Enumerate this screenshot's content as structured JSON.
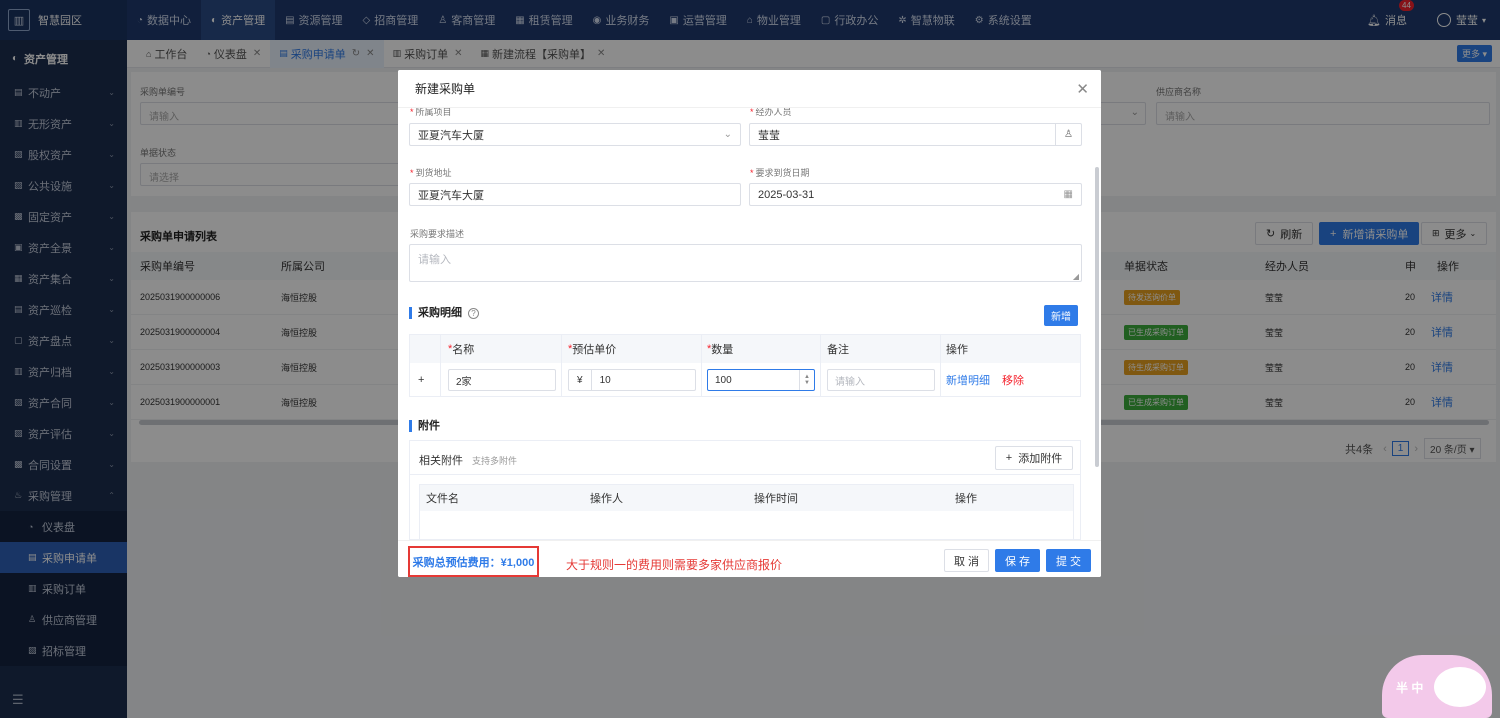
{
  "app": {
    "logo_text": "智慧园区"
  },
  "topnav": [
    {
      "icon": "◔",
      "label": "数据中心"
    },
    {
      "icon": "◐",
      "label": "资产管理",
      "active": true
    },
    {
      "icon": "▤",
      "label": "资源管理"
    },
    {
      "icon": "◇",
      "label": "招商管理"
    },
    {
      "icon": "♙",
      "label": "客商管理"
    },
    {
      "icon": "▦",
      "label": "租赁管理"
    },
    {
      "icon": "◉",
      "label": "业务财务"
    },
    {
      "icon": "▣",
      "label": "运营管理"
    },
    {
      "icon": "⌂",
      "label": "物业管理"
    },
    {
      "icon": "▢",
      "label": "行政办公"
    },
    {
      "icon": "✲",
      "label": "智慧物联"
    },
    {
      "icon": "⚙",
      "label": "系统设置"
    }
  ],
  "top_right": {
    "message_label": "消息",
    "message_count": "44",
    "user_name": "莹莹"
  },
  "sidebar": {
    "title": "资产管理",
    "items": [
      {
        "icon": "▤",
        "label": "不动产"
      },
      {
        "icon": "▥",
        "label": "无形资产"
      },
      {
        "icon": "▧",
        "label": "股权资产"
      },
      {
        "icon": "▨",
        "label": "公共设施"
      },
      {
        "icon": "▩",
        "label": "固定资产"
      },
      {
        "icon": "▣",
        "label": "资产全景"
      },
      {
        "icon": "▦",
        "label": "资产集合"
      },
      {
        "icon": "▤",
        "label": "资产巡检"
      },
      {
        "icon": "▢",
        "label": "资产盘点"
      },
      {
        "icon": "▥",
        "label": "资产归档"
      },
      {
        "icon": "▧",
        "label": "资产合同"
      },
      {
        "icon": "▨",
        "label": "资产评估"
      },
      {
        "icon": "▩",
        "label": "合同设置"
      },
      {
        "icon": "♨",
        "label": "采购管理",
        "open": true
      }
    ],
    "sub_items": [
      {
        "icon": "◔",
        "label": "仪表盘"
      },
      {
        "icon": "▤",
        "label": "采购申请单",
        "active": true
      },
      {
        "icon": "▥",
        "label": "采购订单"
      },
      {
        "icon": "♙",
        "label": "供应商管理"
      },
      {
        "icon": "▧",
        "label": "招标管理"
      }
    ],
    "footer_icon": "☰"
  },
  "tabs": [
    {
      "icon": "⌂",
      "label": "工作台",
      "closable": false
    },
    {
      "icon": "◔",
      "label": "仪表盘",
      "closable": true
    },
    {
      "icon": "▤",
      "label": "采购申请单",
      "closable": true,
      "active": true
    },
    {
      "icon": "▥",
      "label": "采购订单",
      "closable": true
    },
    {
      "icon": "▦",
      "label": "新建流程【采购单】",
      "closable": true
    }
  ],
  "tabs_more": "更多 ▾",
  "filter": {
    "code_label": "采购单编号",
    "code_placeholder": "请输入",
    "supplier_label": "供应商名称",
    "supplier_placeholder": "请输入",
    "status_label": "单据状态",
    "status_placeholder": "请选择"
  },
  "list": {
    "title": "采购单申请列表",
    "refresh_label": "刷新",
    "add_label": "新增请采购单",
    "more_label": "更多",
    "columns": [
      "采购单编号",
      "所属公司",
      "单据状态",
      "经办人员",
      "申",
      "操作"
    ],
    "rows": [
      {
        "code": "2025031900000006",
        "company": "海恒控股",
        "status": "待发送询价单",
        "status_color": "orange",
        "handler": "莹莹",
        "col5": "20",
        "action": "详情"
      },
      {
        "code": "2025031900000004",
        "company": "海恒控股",
        "status": "已生成采购订单",
        "status_color": "green",
        "handler": "莹莹",
        "col5": "20",
        "action": "详情"
      },
      {
        "code": "2025031900000003",
        "company": "海恒控股",
        "status": "待生成采购订单",
        "status_color": "orange",
        "handler": "莹莹",
        "col5": "20",
        "action": "详情"
      },
      {
        "code": "2025031900000001",
        "company": "海恒控股",
        "status": "已生成采购订单",
        "status_color": "green",
        "handler": "莹莹",
        "col5": "20",
        "action": "详情"
      }
    ],
    "pager": {
      "total": "共4条",
      "page": "1",
      "page_size": "20 条/页 ▾"
    }
  },
  "modal": {
    "title": "新建采购单",
    "project_label": "所属项目",
    "project_value": "亚夏汽车大厦",
    "handler_label": "经办人员",
    "handler_value": "莹莹",
    "address_label": "到货地址",
    "address_value": "亚夏汽车大厦",
    "date_label": "要求到货日期",
    "date_value": "2025-03-31",
    "desc_label": "采购要求描述",
    "desc_placeholder": "请输入",
    "detail_title": "采购明细",
    "detail_add": "新增",
    "detail_columns": {
      "name": "名称",
      "price": "预估单价",
      "qty": "数量",
      "remark": "备注",
      "op": "操作"
    },
    "detail_row": {
      "expand": "+",
      "name": "2家",
      "currency": "¥",
      "price": "10",
      "qty": "100",
      "remark_placeholder": "请输入",
      "add_link": "新增明细",
      "remove_link": "移除"
    },
    "attach_title": "附件",
    "attach_label": "相关附件",
    "attach_hint": "支持多附件",
    "attach_add": "添加附件",
    "attach_columns": [
      "文件名",
      "操作人",
      "操作时间",
      "操作"
    ],
    "total_text": "采购总预估费用：¥1,000",
    "note_text": "大于规则一的费用则需要多家供应商报价",
    "cancel_label": "取 消",
    "save_label": "保 存",
    "submit_label": "提 交"
  },
  "mascot": {
    "text": "半 中"
  }
}
